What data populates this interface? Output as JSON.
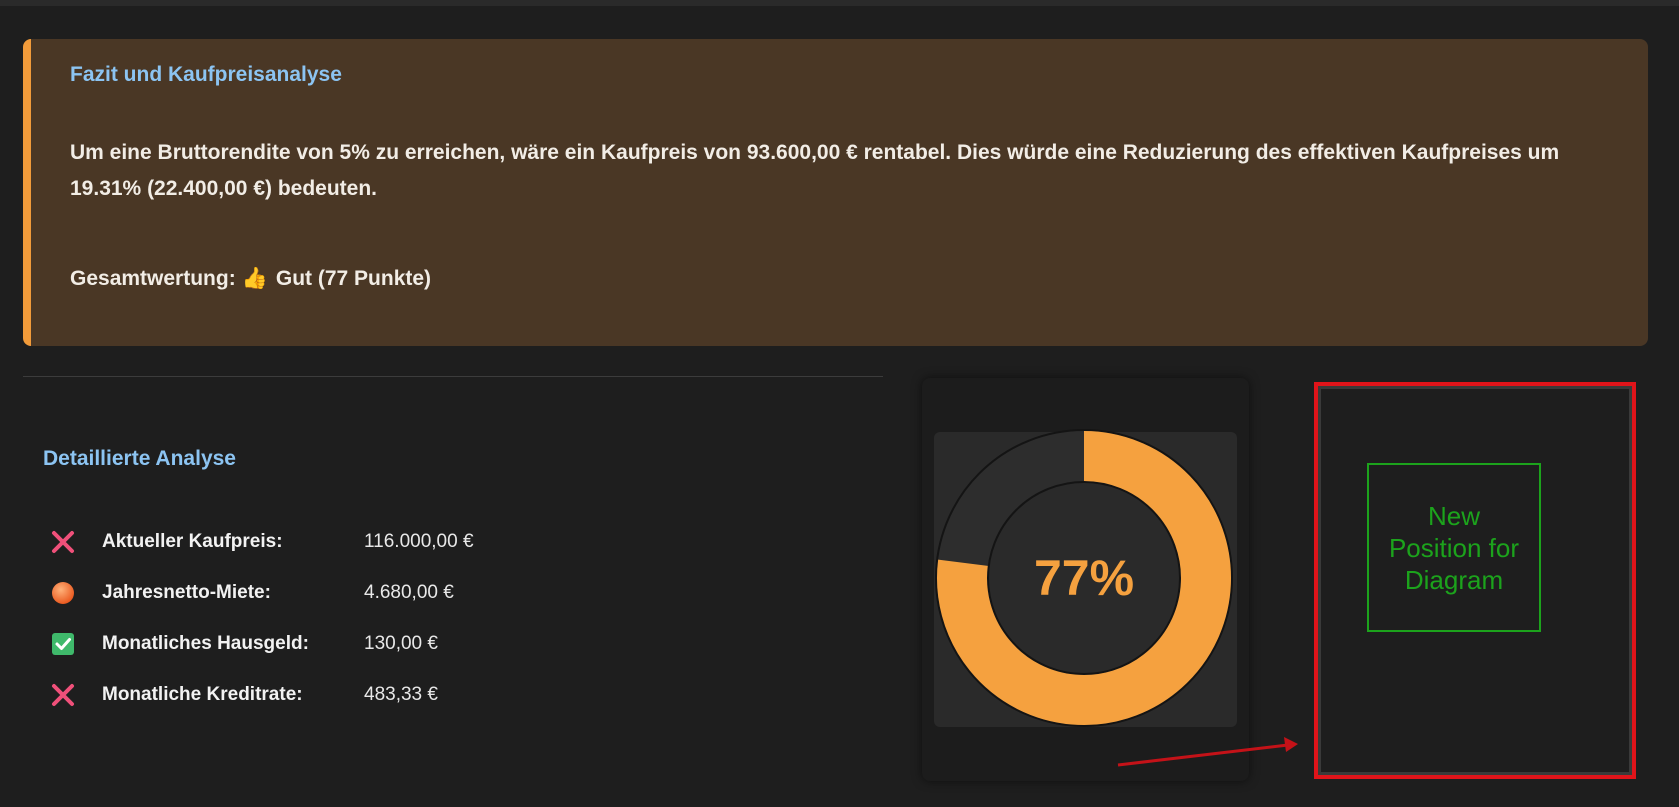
{
  "summary": {
    "title": "Fazit und Kaufpreisanalyse",
    "text_part1": "Um eine Bruttorendite von 5% zu erreichen, wäre ein Kaufpreis von ",
    "text_price": "93.600,00 €",
    "text_part2": " rentabel. Dies würde eine Reduzierung des effektiven Kaufpreises um ",
    "text_percent": "19.31%",
    "text_part3": " (22.400,00 €) bedeuten.",
    "rating_label": "Gesamtwertung:",
    "rating_icon": "👍",
    "rating_value": "Gut (77 Punkte)",
    "accent_color": "#f29b3a",
    "title_color": "#8cc4f2"
  },
  "analysis": {
    "title": "Detaillierte Analyse",
    "rows": [
      {
        "icon": "cross-icon",
        "label": "Aktueller Kaufpreis:",
        "value": "116.000,00 €"
      },
      {
        "icon": "orange-circle-icon",
        "label": "Jahresnetto-Miete:",
        "value": "4.680,00 €"
      },
      {
        "icon": "check-box-icon",
        "label": "Monatliches Hausgeld:",
        "value": "130,00 €"
      },
      {
        "icon": "cross-icon",
        "label": "Monatliche Kreditrate:",
        "value": "483,33 €"
      }
    ]
  },
  "score": {
    "percent": 77,
    "label": "77%",
    "fill_color": "#f5a13f",
    "track_color": "#2d2d2d"
  },
  "annotation": {
    "text": "New\nPosition for\nDiagram",
    "frame_color": "#e0141a",
    "box_color": "#1ca31c"
  }
}
